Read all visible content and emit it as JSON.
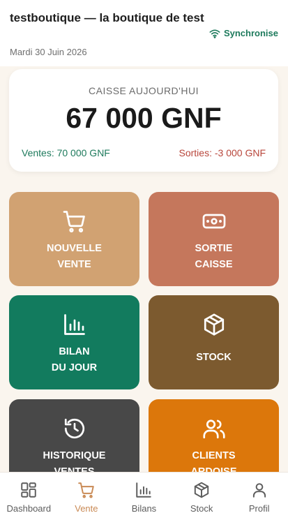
{
  "header": {
    "shop_name": "testboutique — la boutique de test",
    "date": "Mardi 30 Juin 2026",
    "sync_label": "Synchronise",
    "sync_icon": "wifi-icon",
    "sync_color": "#1d7a5c"
  },
  "cash": {
    "label": "CAISSE AUJOURD'HUI",
    "amount": "67 000 GNF",
    "sales": "Ventes: 70 000 GNF",
    "outflows": "Sorties: -3 000 GNF",
    "sales_color": "#1d7a5c",
    "outflows_color": "#b8463b"
  },
  "actions": [
    {
      "label": "NOUVELLE\nVENTE",
      "icon": "cart-icon",
      "color": "#d1a272"
    },
    {
      "label": "SORTIE\nCAISSE",
      "icon": "banknote-icon",
      "color": "#c5775c"
    },
    {
      "label": "BILAN\nDU JOUR",
      "icon": "bar-chart-icon",
      "color": "#127b5e"
    },
    {
      "label": "STOCK",
      "icon": "package-icon",
      "color": "#7c5a2f"
    },
    {
      "label": "HISTORIQUE\nVENTES",
      "icon": "history-icon",
      "color": "#484848"
    },
    {
      "label": "CLIENTS\nARDOISE",
      "icon": "users-icon",
      "color": "#dc770b"
    }
  ],
  "nav": {
    "active": "Vente",
    "active_color": "#c98a55",
    "items": [
      {
        "label": "Dashboard",
        "icon": "dashboard-icon"
      },
      {
        "label": "Vente",
        "icon": "cart-icon"
      },
      {
        "label": "Bilans",
        "icon": "bar-chart-icon"
      },
      {
        "label": "Stock",
        "icon": "package-icon"
      },
      {
        "label": "Profil",
        "icon": "user-icon"
      }
    ]
  }
}
